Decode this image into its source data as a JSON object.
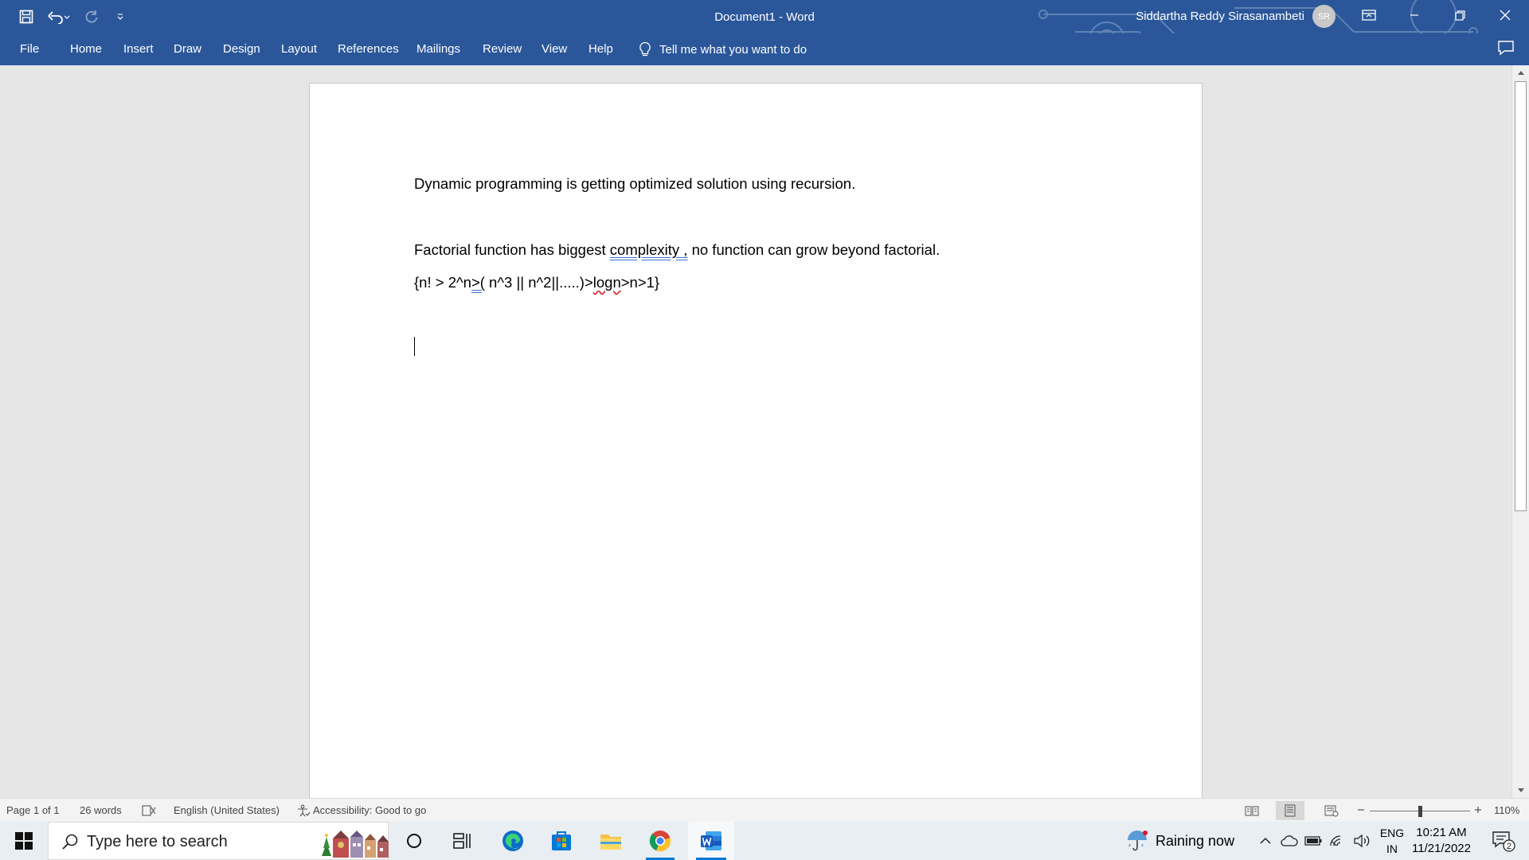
{
  "window": {
    "title": "Document1  -  Word",
    "user_name": "Siddartha Reddy Sirasanambeti",
    "avatar_initials": "SR"
  },
  "ribbon": {
    "tabs": [
      "File",
      "Home",
      "Insert",
      "Draw",
      "Design",
      "Layout",
      "References",
      "Mailings",
      "Review",
      "View",
      "Help"
    ],
    "tell_me": "Tell me what you want to do"
  },
  "document": {
    "line1": "Dynamic programming is getting optimized solution using recursion.",
    "line2_pre": "Factorial function has biggest ",
    "line2_underlined": "complexity ,",
    "line2_post": " no function can grow beyond factorial.",
    "line3_a": "{n! > 2^n",
    "line3_b": ">(",
    "line3_c": " n^3 || n^2||.....)>",
    "line3_d": "logn",
    "line3_e": ">n>1}"
  },
  "statusbar": {
    "page": "Page 1 of 1",
    "words": "26 words",
    "language": "English (United States)",
    "accessibility": "Accessibility: Good to go",
    "zoom": "110%"
  },
  "taskbar": {
    "search_placeholder": "Type here to search",
    "weather": "Raining now",
    "lang_top": "ENG",
    "lang_bottom": "IN",
    "time": "10:21 AM",
    "date": "11/21/2022",
    "notification_count": "2"
  },
  "colors": {
    "word_blue": "#2b579a",
    "accent": "#0078d4"
  }
}
